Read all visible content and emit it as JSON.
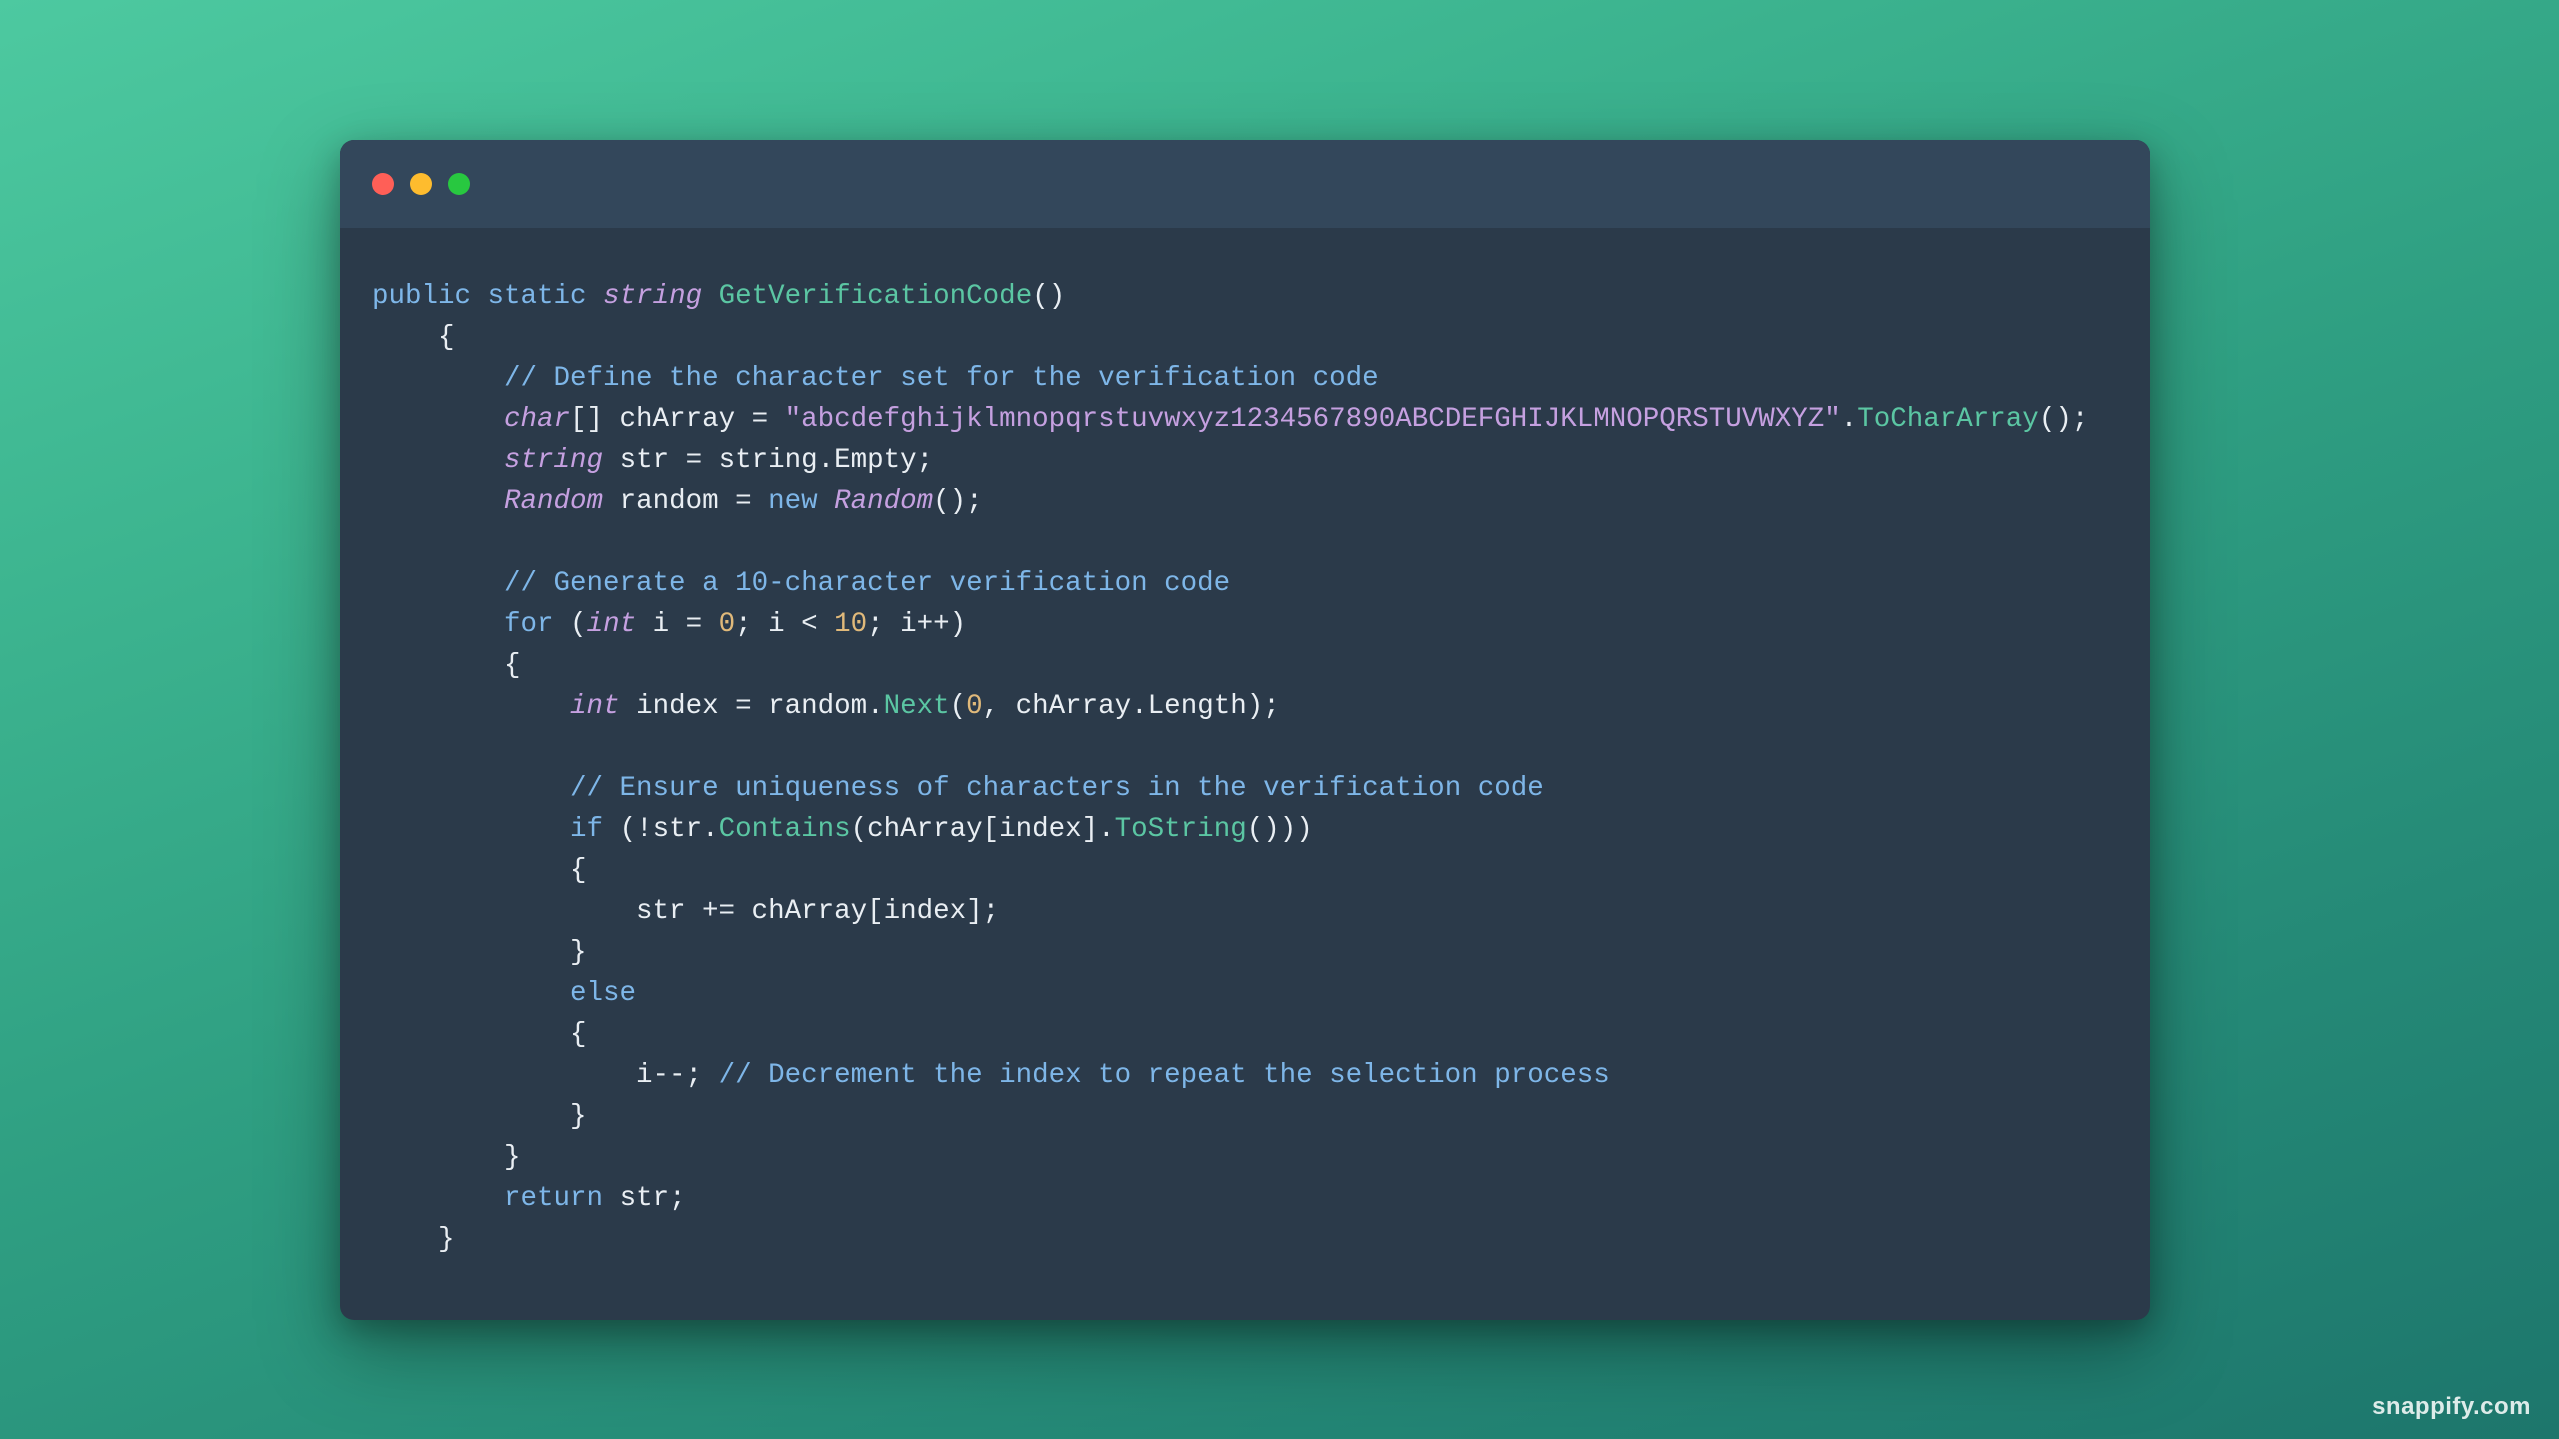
{
  "watermark": "snappify.com",
  "code": {
    "tokens": [
      [
        [
          "kw",
          "public"
        ],
        [
          "op",
          " "
        ],
        [
          "kw",
          "static"
        ],
        [
          "op",
          " "
        ],
        [
          "type",
          "string"
        ],
        [
          "op",
          " "
        ],
        [
          "fn",
          "GetVerificationCode"
        ],
        [
          "op",
          "()"
        ]
      ],
      [
        [
          "op",
          "    {"
        ]
      ],
      [
        [
          "op",
          "        "
        ],
        [
          "comment",
          "// Define the character set for the verification code"
        ]
      ],
      [
        [
          "op",
          "        "
        ],
        [
          "type",
          "char"
        ],
        [
          "op",
          "[] chArray = "
        ],
        [
          "str",
          "\"abcdefghijklmnopqrstuvwxyz1234567890ABCDEFGHIJKLMNOPQRSTUVWXYZ\""
        ],
        [
          "op",
          "."
        ],
        [
          "fn",
          "ToCharArray"
        ],
        [
          "op",
          "();"
        ]
      ],
      [
        [
          "op",
          "        "
        ],
        [
          "type",
          "string"
        ],
        [
          "op",
          " str = string.Empty;"
        ]
      ],
      [
        [
          "op",
          "        "
        ],
        [
          "type",
          "Random"
        ],
        [
          "op",
          " random = "
        ],
        [
          "kw",
          "new"
        ],
        [
          "op",
          " "
        ],
        [
          "type",
          "Random"
        ],
        [
          "op",
          "();"
        ]
      ],
      [
        [
          "op",
          ""
        ]
      ],
      [
        [
          "op",
          "        "
        ],
        [
          "comment",
          "// Generate a 10-character verification code"
        ]
      ],
      [
        [
          "op",
          "        "
        ],
        [
          "kw",
          "for"
        ],
        [
          "op",
          " ("
        ],
        [
          "type",
          "int"
        ],
        [
          "op",
          " i = "
        ],
        [
          "num",
          "0"
        ],
        [
          "op",
          "; i < "
        ],
        [
          "num",
          "10"
        ],
        [
          "op",
          "; i++)"
        ]
      ],
      [
        [
          "op",
          "        {"
        ]
      ],
      [
        [
          "op",
          "            "
        ],
        [
          "type",
          "int"
        ],
        [
          "op",
          " index = random."
        ],
        [
          "fn",
          "Next"
        ],
        [
          "op",
          "("
        ],
        [
          "num",
          "0"
        ],
        [
          "op",
          ", chArray.Length);"
        ]
      ],
      [
        [
          "op",
          ""
        ]
      ],
      [
        [
          "op",
          "            "
        ],
        [
          "comment",
          "// Ensure uniqueness of characters in the verification code"
        ]
      ],
      [
        [
          "op",
          "            "
        ],
        [
          "kw",
          "if"
        ],
        [
          "op",
          " (!str."
        ],
        [
          "fn",
          "Contains"
        ],
        [
          "op",
          "(chArray[index]."
        ],
        [
          "fn",
          "ToString"
        ],
        [
          "op",
          "()))"
        ]
      ],
      [
        [
          "op",
          "            {"
        ]
      ],
      [
        [
          "op",
          "                str += chArray[index];"
        ]
      ],
      [
        [
          "op",
          "            }"
        ]
      ],
      [
        [
          "op",
          "            "
        ],
        [
          "kw",
          "else"
        ]
      ],
      [
        [
          "op",
          "            {"
        ]
      ],
      [
        [
          "op",
          "                i--; "
        ],
        [
          "comment",
          "// Decrement the index to repeat the selection process"
        ]
      ],
      [
        [
          "op",
          "            }"
        ]
      ],
      [
        [
          "op",
          "        }"
        ]
      ],
      [
        [
          "op",
          "        "
        ],
        [
          "kw",
          "return"
        ],
        [
          "op",
          " str;"
        ]
      ],
      [
        [
          "op",
          "    }"
        ]
      ]
    ]
  }
}
